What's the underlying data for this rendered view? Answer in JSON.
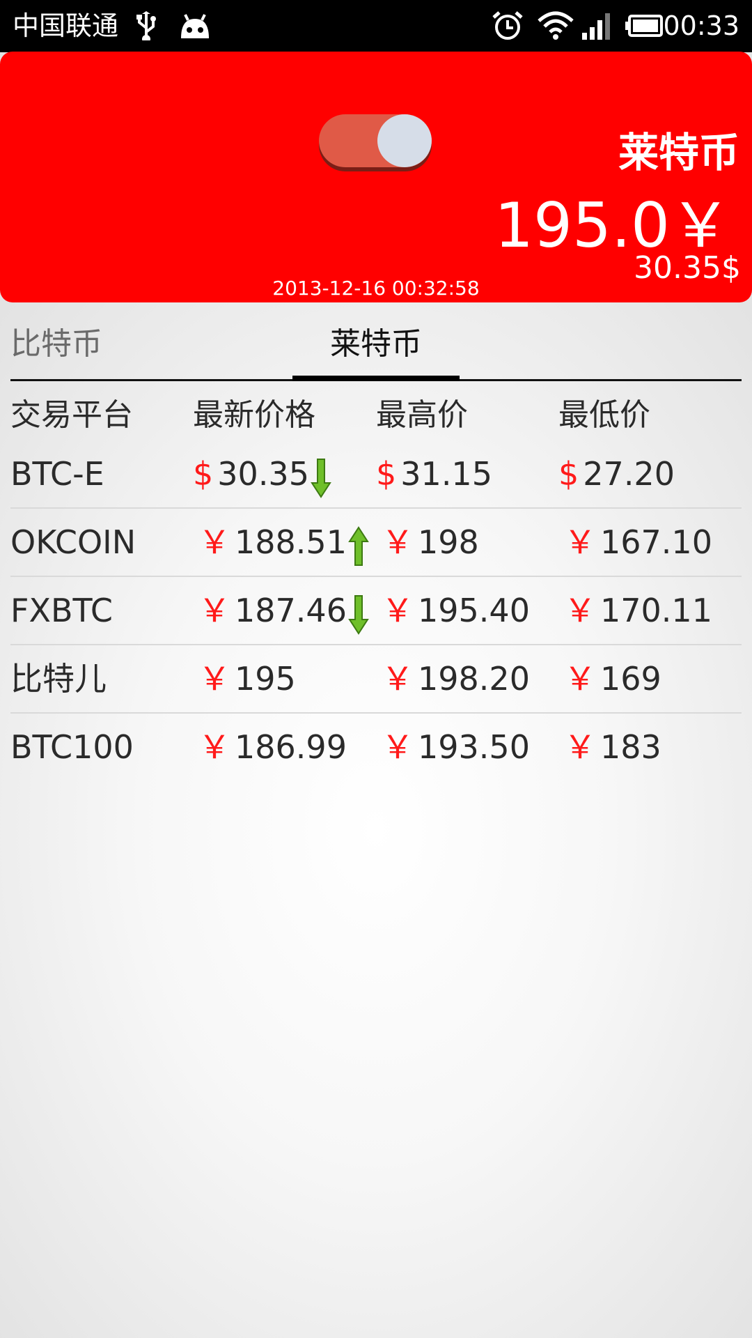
{
  "status_bar": {
    "carrier": "中国联通",
    "time": "00:33",
    "icons": [
      "usb-icon",
      "android-icon",
      "alarm-icon",
      "wifi-icon",
      "signal-icon",
      "battery-icon"
    ]
  },
  "header": {
    "coin_name": "莱特币",
    "price_cny": "195.0￥",
    "price_usd": "30.35$",
    "updated_at": "2013-12-16 00:32:58",
    "toggle_on": true
  },
  "tabs": [
    {
      "label": "比特币",
      "active": false
    },
    {
      "label": "莱特币",
      "active": true
    }
  ],
  "table": {
    "headers": [
      "交易平台",
      "最新价格",
      "最高价",
      "最低价"
    ],
    "rows": [
      {
        "platform": "BTC-E",
        "currency": "$",
        "last": "30.35",
        "trend": "down",
        "high": "31.15",
        "low": "27.20"
      },
      {
        "platform": "OKCOIN",
        "currency": "￥",
        "last": "188.51",
        "trend": "up",
        "high": "198",
        "low": "167.10"
      },
      {
        "platform": "FXBTC",
        "currency": "￥",
        "last": "187.46",
        "trend": "down",
        "high": "195.40",
        "low": "170.11"
      },
      {
        "platform": "比特儿",
        "currency": "￥",
        "last": "195",
        "trend": "",
        "high": "198.20",
        "low": "169"
      },
      {
        "platform": "BTC100",
        "currency": "￥",
        "last": "186.99",
        "trend": "",
        "high": "193.50",
        "low": "183"
      }
    ]
  },
  "colors": {
    "header_bg": "#ff0000",
    "currency_symbol": "#ff1a1a",
    "trend_arrow": "#6fbf2a"
  }
}
